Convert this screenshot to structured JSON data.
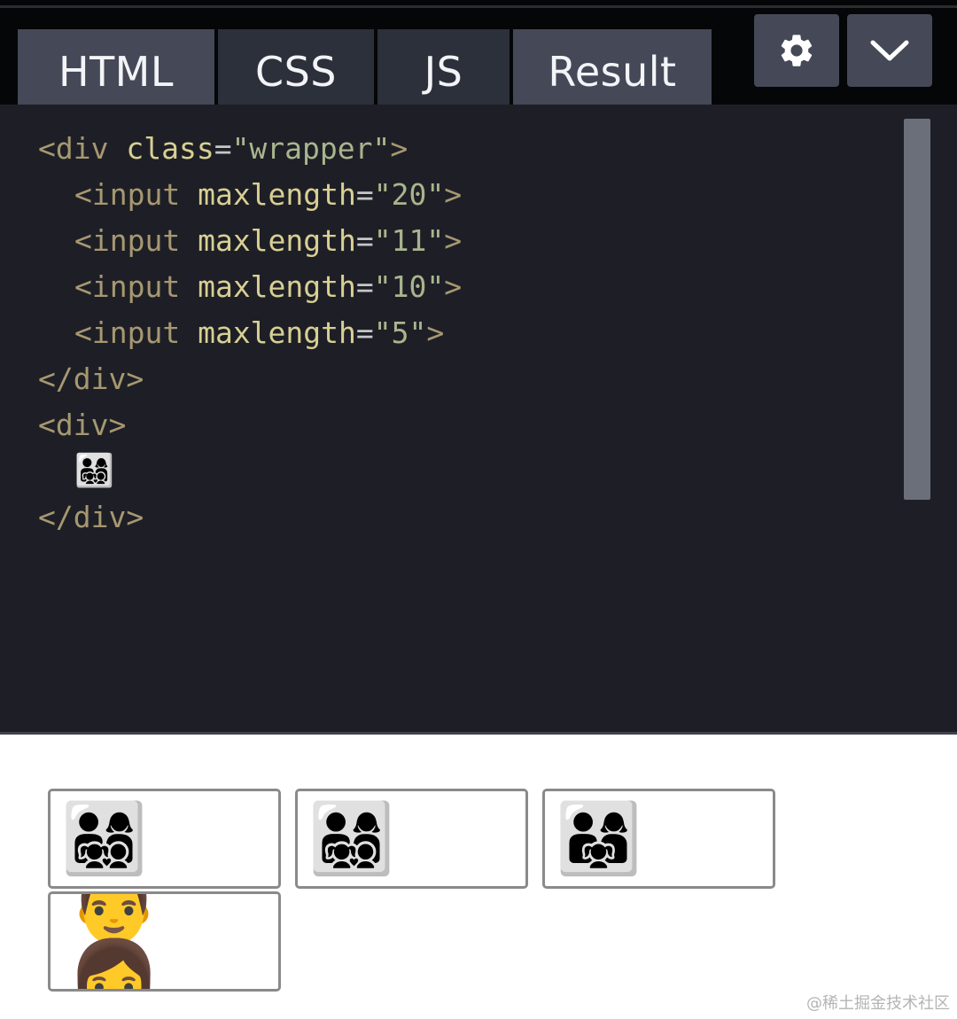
{
  "tabs": {
    "html": "HTML",
    "css": "CSS",
    "js": "JS",
    "result": "Result"
  },
  "toolbar": {
    "settings_icon": "gear-icon",
    "collapse_icon": "chevron-down-icon"
  },
  "code": {
    "line1": {
      "open": "<div ",
      "attr": "class",
      "eq": "=",
      "val": "\"wrapper\"",
      "close": ">"
    },
    "line2": {
      "open": "<input ",
      "attr": "maxlength",
      "eq": "=",
      "val": "\"20\"",
      "close": ">"
    },
    "line3": {
      "open": "<input ",
      "attr": "maxlength",
      "eq": "=",
      "val": "\"11\"",
      "close": ">"
    },
    "line4": {
      "open": "<input ",
      "attr": "maxlength",
      "eq": "=",
      "val": "\"10\"",
      "close": ">"
    },
    "line5": {
      "open": "<input ",
      "attr": "maxlength",
      "eq": "=",
      "val": "\"5\"",
      "close": ">"
    },
    "line6": "</div>",
    "line7": "<div>",
    "line8": "👨‍👩‍👧‍👦",
    "line9": "</div>"
  },
  "result": {
    "input1_value": "👨‍👩‍👧‍👦",
    "input2_value": "👨‍👩‍👧‍👦",
    "input3_value": "👨‍👩‍👧",
    "input4_value": "👨👩"
  },
  "watermark": "@稀土掘金技术社区",
  "colors": {
    "topbar": "#050607",
    "tab_active": "#444857",
    "tab_inactive": "#2c303a",
    "editor_bg": "#1e1f26",
    "tag": "#a79872",
    "attr": "#d8cf93",
    "string": "#a8b58d",
    "scrollbar": "#6b6f7a"
  }
}
